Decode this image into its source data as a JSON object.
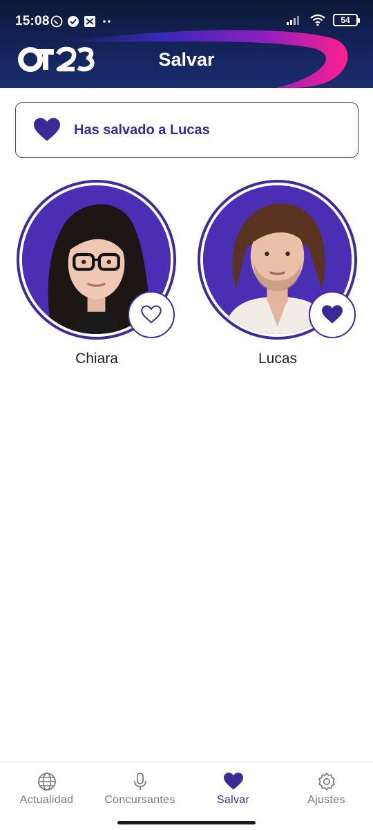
{
  "status_bar": {
    "time": "15:08",
    "battery": "54",
    "left_icons": [
      "whatsapp-icon",
      "check-circle-icon",
      "tiktok-icon",
      "more-dots-icon"
    ],
    "right_icons": [
      "signal-icon",
      "wifi-icon",
      "battery-icon"
    ]
  },
  "header": {
    "logo_text": "OT23",
    "title": "Salvar"
  },
  "banner": {
    "text": "Has salvado a Lucas",
    "icon": "heart-filled-icon"
  },
  "contestants": [
    {
      "name": "Chiara",
      "saved": false
    },
    {
      "name": "Lucas",
      "saved": true
    }
  ],
  "nav": {
    "items": [
      {
        "label": "Actualidad",
        "icon": "globe-icon",
        "active": false
      },
      {
        "label": "Concursantes",
        "icon": "microphone-icon",
        "active": false
      },
      {
        "label": "Salvar",
        "icon": "heart-icon",
        "active": true
      },
      {
        "label": "Ajustes",
        "icon": "gear-icon",
        "active": false
      }
    ]
  },
  "colors": {
    "accent": "#3b2a95",
    "header_dark": "#14245a",
    "swoosh_pink": "#e0209a",
    "avatar_bg": "#4a2fb5"
  }
}
